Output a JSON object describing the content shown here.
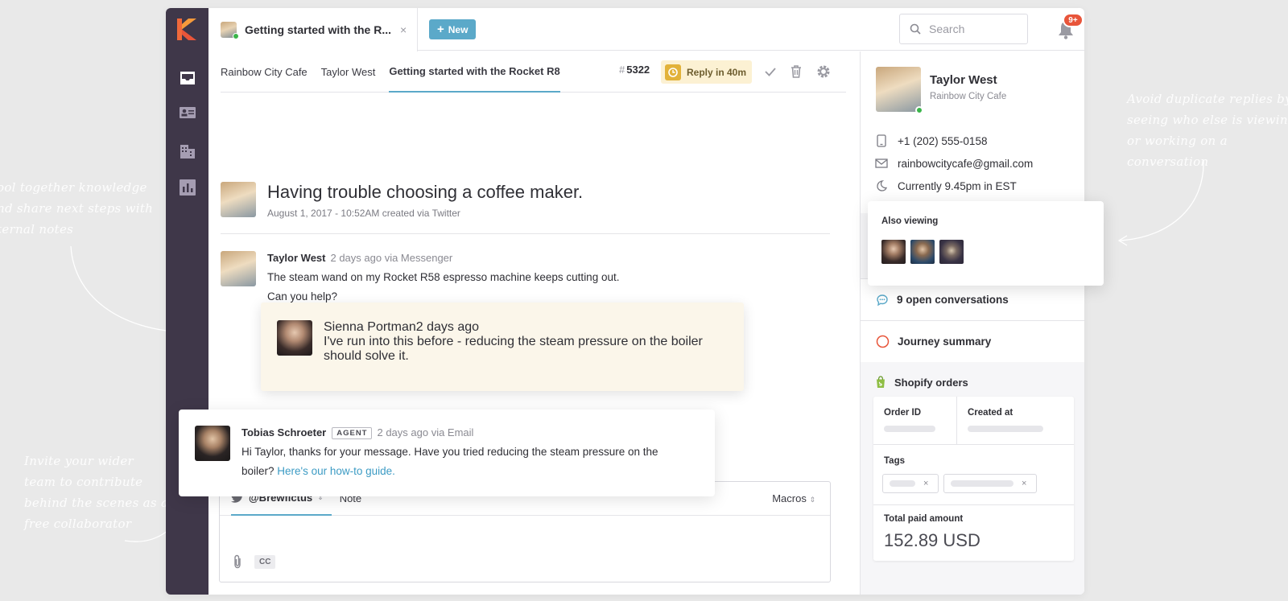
{
  "annotations": {
    "left_top": "ool together knowledge nd share next steps with ternal notes",
    "left_bottom": "Invite your wider team to contribute behind the scenes as a free collaborator",
    "right": "Avoid duplicate replies by seeing who else is viewing or working on a conversation"
  },
  "topbar": {
    "tab_title": "Getting started with the R...",
    "tab_close": "×",
    "new_button": "New",
    "new_icon": "+",
    "search_placeholder": "Search",
    "notifications_badge": "9+"
  },
  "breadcrumbs": [
    {
      "label": "Rainbow City Cafe"
    },
    {
      "label": "Taylor West"
    },
    {
      "label": "Getting started with the Rocket R8"
    }
  ],
  "ticket": {
    "hash": "#",
    "number": "5322",
    "reply_sla": "Reply in 40m"
  },
  "conversation": {
    "subject": "Having trouble choosing a coffee maker.",
    "meta": "August 1, 2017 - 10:52AM created via Twitter",
    "messages": [
      {
        "author": "Taylor West",
        "time": "2 days ago via Messenger",
        "line1": "The steam wand on my Rocket R58 espresso machine keeps cutting out.",
        "line2": "Can you help?"
      },
      {
        "author": "Sienna Portman",
        "time": "2 days ago",
        "line1": "I've run into this before - reducing the steam pressure on the boiler",
        "line2": "should solve it."
      },
      {
        "author": "Tobias Schroeter",
        "tag": "AGENT",
        "time": "2 days ago via Email",
        "line1": "Hi Taylor, thanks for your message. Have you tried reducing the steam pressure on the",
        "line2_prefix": "boiler? ",
        "link": "Here's our how-to guide."
      }
    ]
  },
  "composer": {
    "channel": "@Brewfictus",
    "channel_caret": "⇕",
    "note_tab": "Note",
    "macros": "Macros",
    "macros_caret": "⇕",
    "cc": "CC"
  },
  "contact": {
    "name": "Taylor West",
    "company": "Rainbow City Cafe",
    "phone": "+1 (202) 555-0158",
    "email": "rainbowcitycafe@gmail.com",
    "local_time": "Currently 9.45pm in EST"
  },
  "also_viewing": {
    "title": "Also viewing"
  },
  "sections": {
    "open_conversations": "9 open conversations",
    "journey": "Journey summary",
    "shopify": "Shopify orders"
  },
  "shopify": {
    "order_id_label": "Order ID",
    "created_at_label": "Created at",
    "tags_label": "Tags",
    "tag_remove": "×",
    "total_label": "Total paid amount",
    "total_value": "152.89 USD"
  },
  "colors": {
    "sidebar": "#3f3749",
    "accent": "#5ba9c9",
    "note_bg": "#fbf6ea",
    "sla_bg": "#fcf1d3",
    "badge": "#e8553a",
    "online": "#3ab54a"
  }
}
